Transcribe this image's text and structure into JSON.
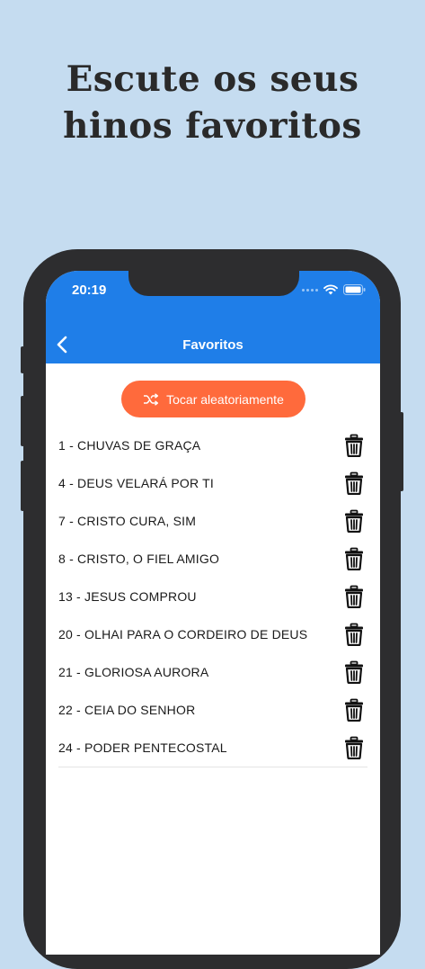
{
  "promo": {
    "title_line1": "Escute os seus",
    "title_line2": "hinos favoritos"
  },
  "status_bar": {
    "time": "20:19"
  },
  "nav": {
    "title": "Favoritos",
    "back_icon": "chevron-left-icon"
  },
  "shuffle": {
    "label": "Tocar aleatoriamente",
    "icon": "shuffle-icon"
  },
  "favorites": [
    {
      "label": "1 - CHUVAS DE GRAÇA"
    },
    {
      "label": "4 - DEUS VELARÁ POR TI"
    },
    {
      "label": "7 - CRISTO CURA, SIM"
    },
    {
      "label": "8 - CRISTO, O FIEL AMIGO"
    },
    {
      "label": "13 - JESUS COMPROU"
    },
    {
      "label": "20 - OLHAI PARA O CORDEIRO DE DEUS"
    },
    {
      "label": "21 - GLORIOSA AURORA"
    },
    {
      "label": "22 - CEIA DO SENHOR"
    },
    {
      "label": "24 - PODER PENTECOSTAL"
    }
  ],
  "colors": {
    "background": "#c5dcf0",
    "header": "#1f7ee8",
    "accent": "#ff6a3c"
  }
}
